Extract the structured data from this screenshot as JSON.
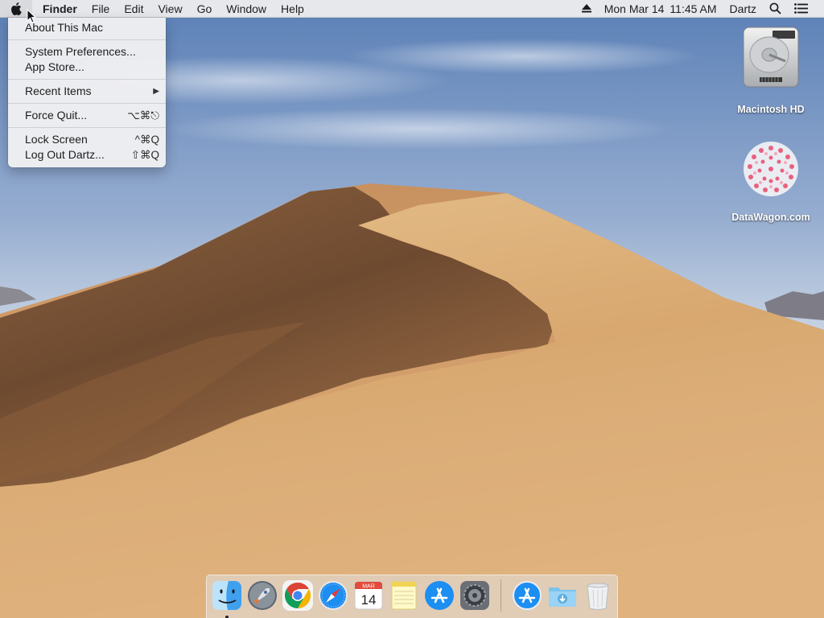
{
  "menubar": {
    "apple_icon": "apple-logo-icon",
    "app_name": "Finder",
    "menus": [
      "File",
      "Edit",
      "View",
      "Go",
      "Window",
      "Help"
    ],
    "status": {
      "eject_icon": "eject-icon",
      "date": "Mon Mar 14",
      "time": "11:45 AM",
      "user": "Dartz",
      "spotlight_icon": "magnifier-icon",
      "notification_icon": "list-icon"
    }
  },
  "apple_menu": {
    "about": "About This Mac",
    "system_preferences": "System Preferences...",
    "app_store": "App Store...",
    "recent_items": "Recent Items",
    "force_quit": "Force Quit...",
    "force_quit_shortcut": "⌥⌘⎋",
    "lock_screen": "Lock Screen",
    "lock_screen_shortcut": "^⌘Q",
    "log_out": "Log Out Dartz...",
    "log_out_shortcut": "⇧⌘Q"
  },
  "desktop_icons": [
    {
      "label": "Macintosh HD",
      "icon": "hard-drive-icon"
    },
    {
      "label": "DataWagon.com",
      "icon": "datawagon-logo-icon"
    }
  ],
  "dock": {
    "apps": [
      {
        "icon": "finder-icon",
        "running": true
      },
      {
        "icon": "launchpad-icon",
        "running": false
      },
      {
        "icon": "chrome-icon",
        "running": false
      },
      {
        "icon": "safari-icon",
        "running": false
      },
      {
        "icon": "calendar-icon",
        "running": false,
        "calendar_month": "MAR",
        "calendar_day": "14"
      },
      {
        "icon": "notes-icon",
        "running": false
      },
      {
        "icon": "app-store-icon",
        "running": false
      },
      {
        "icon": "system-preferences-icon",
        "running": false
      }
    ],
    "stacks": [
      {
        "icon": "applications-folder-icon"
      },
      {
        "icon": "downloads-folder-icon"
      },
      {
        "icon": "trash-icon"
      }
    ]
  },
  "colors": {
    "sky_top": "#5f82b7",
    "sky_bottom": "#dde5ee",
    "dune_light": "#dbb07a",
    "dune_shadow": "#7a5234",
    "menu_bg": "#ececee"
  }
}
